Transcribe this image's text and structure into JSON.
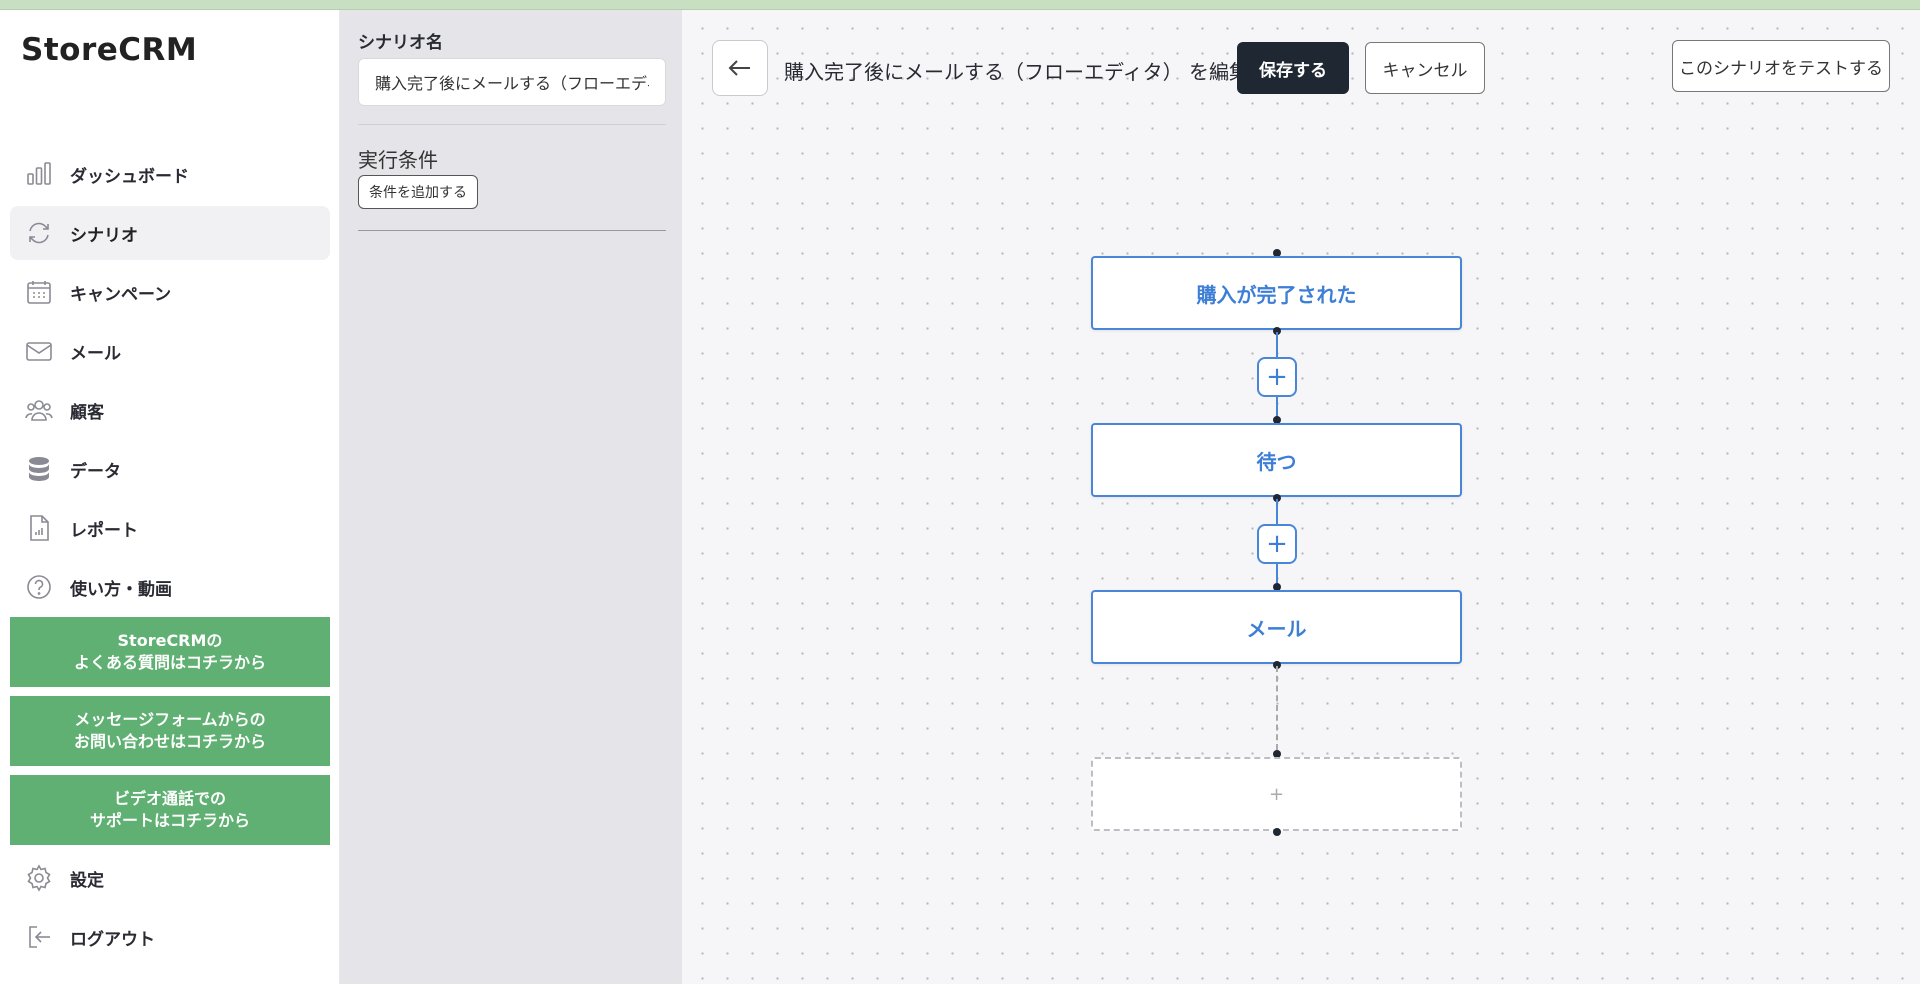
{
  "app": {
    "logo": "StoreCRM"
  },
  "sidebar": {
    "items": [
      {
        "label": "ダッシュボード",
        "icon": "bar-chart-icon",
        "active": false
      },
      {
        "label": "シナリオ",
        "icon": "refresh-icon",
        "active": true
      },
      {
        "label": "キャンペーン",
        "icon": "calendar-icon",
        "active": false
      },
      {
        "label": "メール",
        "icon": "mail-icon",
        "active": false
      },
      {
        "label": "顧客",
        "icon": "users-icon",
        "active": false
      },
      {
        "label": "データ",
        "icon": "database-icon",
        "active": false
      },
      {
        "label": "レポート",
        "icon": "report-icon",
        "active": false
      },
      {
        "label": "使い方・動画",
        "icon": "help-icon",
        "active": false
      }
    ],
    "help_buttons": [
      {
        "label": "StoreCRMの\nよくある質問はコチラから"
      },
      {
        "label": "メッセージフォームからの\nお問い合わせはコチラから"
      },
      {
        "label": "ビデオ通話での\nサポートはコチラから"
      }
    ],
    "bottom_items": [
      {
        "label": "設定",
        "icon": "gear-icon"
      },
      {
        "label": "ログアウト",
        "icon": "logout-icon"
      }
    ],
    "accent_color": "#5fb072"
  },
  "panel": {
    "name_label": "シナリオ名",
    "name_value": "購入完了後にメールする（フローエディタ）",
    "condition_title": "実行条件",
    "add_condition_label": "条件を追加する"
  },
  "toolbar": {
    "editing_text": "購入完了後にメールする（フローエディタ） を編集中",
    "save_label": "保存する",
    "cancel_label": "キャンセル",
    "test_label": "このシナリオをテストする"
  },
  "flow": {
    "nodes": [
      {
        "label": "購入が完了された"
      },
      {
        "label": "待つ"
      },
      {
        "label": "メール"
      }
    ],
    "add_step_symbol": "+",
    "placeholder_symbol": "+",
    "node_color": "#3d7ed6"
  }
}
